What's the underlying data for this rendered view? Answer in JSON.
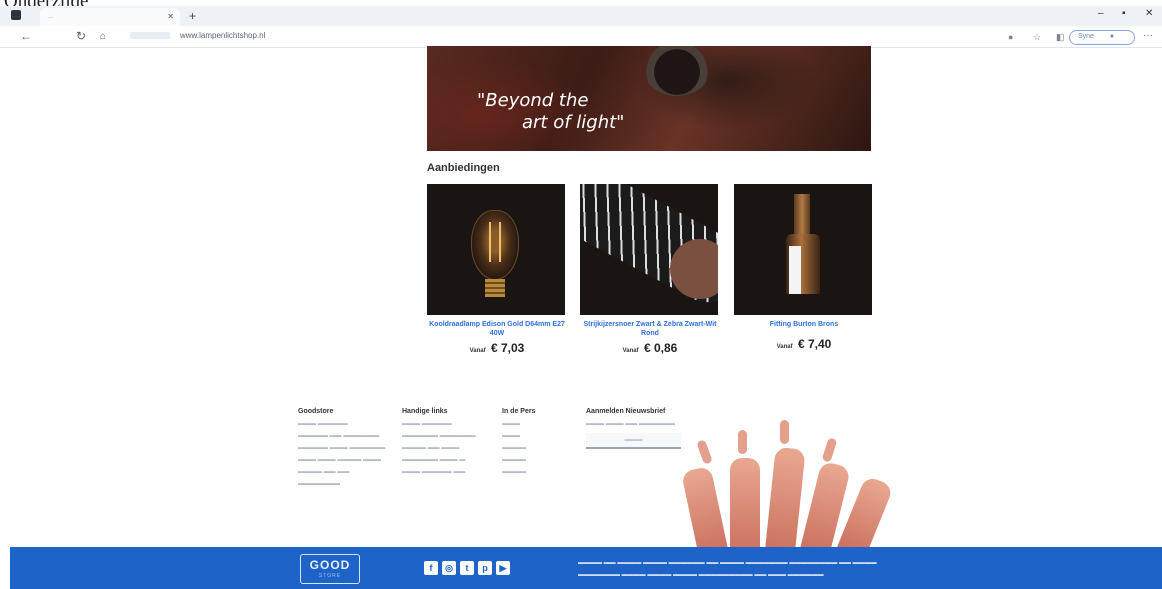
{
  "scan_caption": "Onderzijde",
  "browser": {
    "tab_title": "...",
    "url": "www.lampenlichtshop.nl",
    "profile_label": "Syne"
  },
  "hero": {
    "quote_line1": "\"Beyond the",
    "quote_line2": "art of light\""
  },
  "offers": {
    "title": "Aanbiedingen",
    "products": [
      {
        "name": "Kooldraadlamp Edison Gold D64mm E27 40W",
        "from_label": "Vanaf",
        "price": "€ 7,03"
      },
      {
        "name": "Strijkijzersnoer Zwart & Zebra Zwart-Wit Rond",
        "from_label": "Vanaf",
        "price": "€ 0,86"
      },
      {
        "name": "Fitting Burton Brons",
        "from_label": "Vanaf",
        "price": "€ 7,40"
      }
    ]
  },
  "footer_links": {
    "goodstore": {
      "title": "Goodstore"
    },
    "handy": {
      "title": "Handige links"
    },
    "press": {
      "title": "In de Pers"
    },
    "newsletter": {
      "title": "Aanmelden Nieuwsbrief"
    }
  },
  "footer": {
    "logo_text": "GOOD",
    "logo_sub": "STORE",
    "social_icons": [
      "facebook-icon",
      "instagram-icon",
      "twitter-icon",
      "pinterest-icon",
      "youtube-icon"
    ]
  },
  "colors": {
    "footer_blue": "#1e63c8",
    "link_blue": "#2f6fd6",
    "profile_outline": "#8ba6e6"
  }
}
